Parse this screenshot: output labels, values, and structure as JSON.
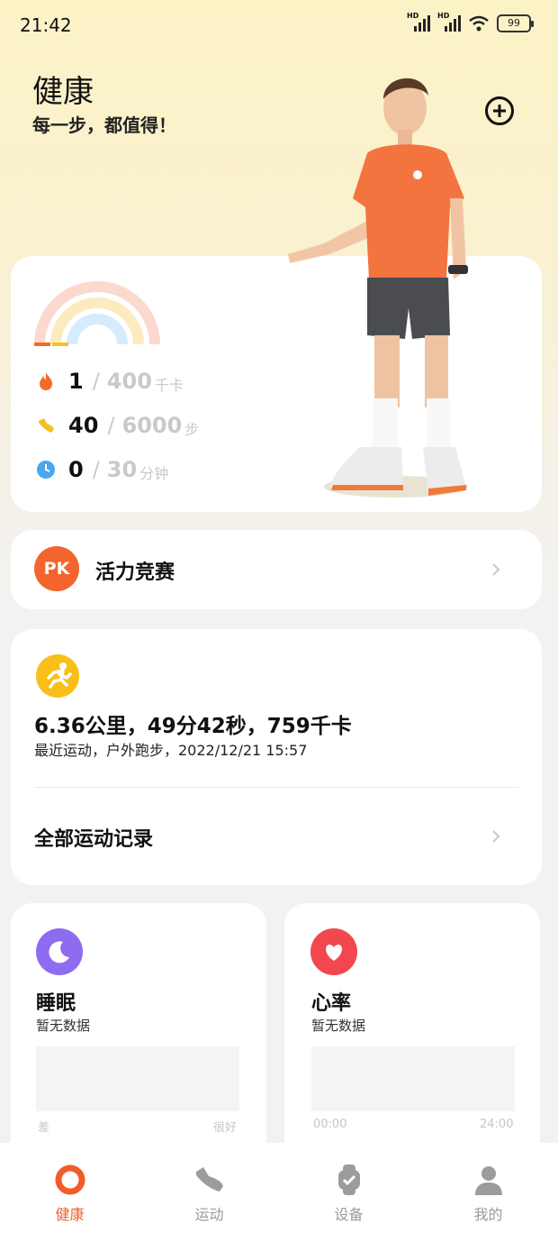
{
  "status_bar": {
    "time": "21:42",
    "battery": "99",
    "net1": "HD",
    "net2": "HD"
  },
  "header": {
    "title": "健康",
    "subtitle": "每一步，都值得！"
  },
  "activity": {
    "calories": {
      "value": "1",
      "goal": "400",
      "unit": "千卡",
      "color": "#f46a28"
    },
    "steps": {
      "value": "40",
      "goal": "6000",
      "unit": "步",
      "color": "#f5c020"
    },
    "minutes": {
      "value": "0",
      "goal": "30",
      "unit": "分钟",
      "color": "#4aa6ef"
    },
    "separator": "/"
  },
  "pk": {
    "badge": "PK",
    "label": "活力竞赛"
  },
  "workout": {
    "summary": "6.36公里，49分42秒，759千卡",
    "detail": "最近运动，户外跑步，2022/12/21 15:57",
    "all_records": "全部运动记录"
  },
  "sleep": {
    "title": "睡眠",
    "status": "暂无数据",
    "axis_left": "差",
    "axis_right": "很好",
    "color": "#8e6cf0"
  },
  "heart": {
    "title": "心率",
    "status": "暂无数据",
    "axis_left": "00:00",
    "axis_right": "24:00",
    "color": "#f2474f"
  },
  "tabs": [
    {
      "label": "健康",
      "icon": "health-ring-icon",
      "active": true
    },
    {
      "label": "运动",
      "icon": "shoe-icon",
      "active": false
    },
    {
      "label": "设备",
      "icon": "watch-icon",
      "active": false
    },
    {
      "label": "我的",
      "icon": "person-icon",
      "active": false
    }
  ],
  "colors": {
    "accent": "#f25c28",
    "inactive": "#9a9a9a"
  }
}
